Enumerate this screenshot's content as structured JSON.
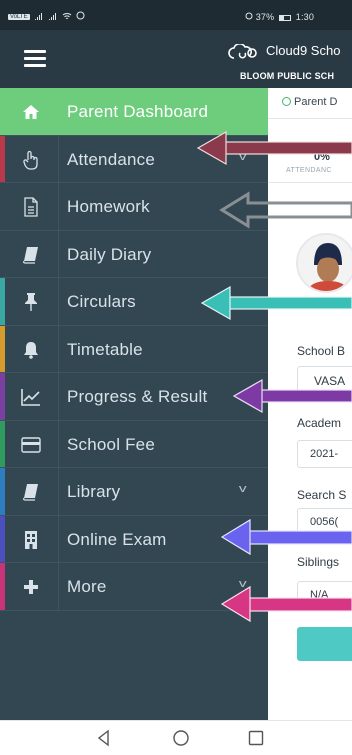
{
  "status_bar": {
    "left_text": "VoLTE",
    "battery": "37%",
    "time": "1:30"
  },
  "app_bar": {
    "brand": "Cloud9 Scho",
    "school": "BLOOM PUBLIC SCH"
  },
  "page": {
    "breadcrumb": "Parent D",
    "attendance_value": "0%",
    "attendance_label": "ATTENDANC",
    "fields": [
      {
        "label": "School B",
        "value": "VASA"
      },
      {
        "label": "Academ",
        "value": "2021-"
      },
      {
        "label": "Search S",
        "value": "0056("
      },
      {
        "label": "Siblings",
        "value": "N/A"
      }
    ]
  },
  "menu": [
    {
      "label": "Parent Dashboard",
      "icon": "home-icon",
      "active": true,
      "stripe": "#6dcd7c",
      "chevron": false
    },
    {
      "label": "Attendance",
      "icon": "hand-pointer-icon",
      "active": false,
      "stripe": "#b8394a",
      "chevron": true
    },
    {
      "label": "Homework",
      "icon": "document-icon",
      "active": false,
      "stripe": "#334752",
      "chevron": false
    },
    {
      "label": "Daily Diary",
      "icon": "book-icon",
      "active": false,
      "stripe": "#334752",
      "chevron": false
    },
    {
      "label": "Circulars",
      "icon": "pin-icon",
      "active": false,
      "stripe": "#3aa7a3",
      "chevron": false
    },
    {
      "label": "Timetable",
      "icon": "bell-icon",
      "active": false,
      "stripe": "#d69b2d",
      "chevron": false
    },
    {
      "label": "Progress & Result",
      "icon": "chart-icon",
      "active": false,
      "stripe": "#7a3fa0",
      "chevron": false
    },
    {
      "label": "School Fee",
      "icon": "credit-card-icon",
      "active": false,
      "stripe": "#2f9b5e",
      "chevron": false
    },
    {
      "label": "Library",
      "icon": "book-icon",
      "active": false,
      "stripe": "#2f7dc1",
      "chevron": true
    },
    {
      "label": "Online Exam",
      "icon": "building-icon",
      "active": false,
      "stripe": "#4b4fc0",
      "chevron": false
    },
    {
      "label": "More",
      "icon": "plus-icon",
      "active": false,
      "stripe": "#c9337a",
      "chevron": true
    }
  ],
  "colors": {
    "drawer_bg": "#334752",
    "active_bg": "#6dcd7c",
    "appbar_bg": "#2a3a44"
  }
}
